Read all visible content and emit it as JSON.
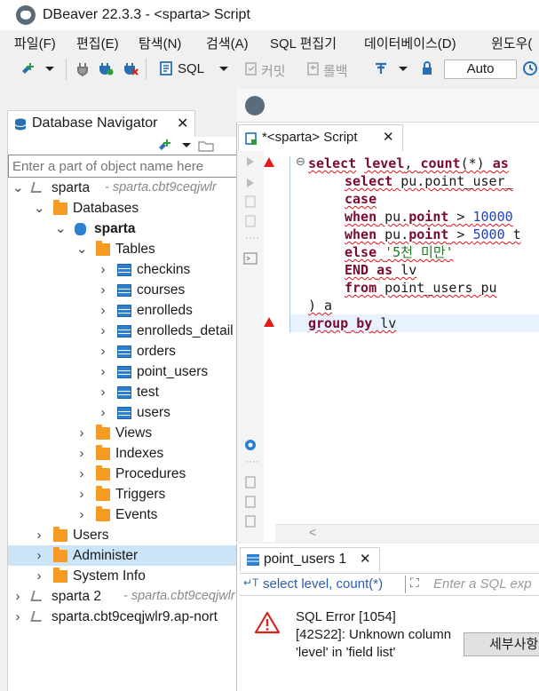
{
  "window": {
    "title": "DBeaver 22.3.3 - <sparta> Script"
  },
  "menu": [
    "파일(F)",
    "편집(E)",
    "탐색(N)",
    "검색(A)",
    "SQL 편집기",
    "데이터베이스(D)",
    "윈도우("
  ],
  "toolbar": {
    "sql_label": "SQL",
    "commit_label": "커밋",
    "rollback_label": "롤백",
    "auto_label": "Auto"
  },
  "navigator": {
    "tab_title": "Database Navigator",
    "search_placeholder": "Enter a part of object name here",
    "tree": [
      {
        "label": "sparta",
        "detail": "- sparta.cbt9ceqjwlr",
        "depth": 0,
        "expanded": true,
        "icon": "connection-icon"
      },
      {
        "label": "Databases",
        "depth": 1,
        "expanded": true,
        "icon": "databases-icon"
      },
      {
        "label": "sparta",
        "depth": 2,
        "expanded": true,
        "icon": "database-icon",
        "bold": true
      },
      {
        "label": "Tables",
        "depth": 3,
        "expanded": true,
        "icon": "tables-folder-icon"
      },
      {
        "label": "checkins",
        "depth": 4,
        "icon": "table-icon"
      },
      {
        "label": "courses",
        "depth": 4,
        "icon": "table-icon"
      },
      {
        "label": "enrolleds",
        "depth": 4,
        "icon": "table-icon"
      },
      {
        "label": "enrolleds_detail",
        "depth": 4,
        "icon": "table-icon"
      },
      {
        "label": "orders",
        "depth": 4,
        "icon": "table-icon"
      },
      {
        "label": "point_users",
        "depth": 4,
        "icon": "table-icon"
      },
      {
        "label": "test",
        "depth": 4,
        "icon": "table-icon"
      },
      {
        "label": "users",
        "depth": 4,
        "icon": "table-icon"
      },
      {
        "label": "Views",
        "depth": 3,
        "icon": "views-icon"
      },
      {
        "label": "Indexes",
        "depth": 3,
        "icon": "folder-icon"
      },
      {
        "label": "Procedures",
        "depth": 3,
        "icon": "folder-icon"
      },
      {
        "label": "Triggers",
        "depth": 3,
        "icon": "folder-icon"
      },
      {
        "label": "Events",
        "depth": 3,
        "icon": "folder-icon"
      },
      {
        "label": "Users",
        "depth": 1,
        "icon": "users-folder-icon"
      },
      {
        "label": "Administer",
        "depth": 1,
        "icon": "administer-folder-icon",
        "selected": true
      },
      {
        "label": "System Info",
        "depth": 1,
        "icon": "system-info-folder-icon"
      },
      {
        "label": "sparta 2",
        "detail": "- sparta.cbt9ceqjwlr",
        "depth": 0,
        "icon": "connection-icon"
      },
      {
        "label": "sparta.cbt9ceqjwlr9.ap-nort",
        "depth": 0,
        "icon": "connection-icon"
      }
    ]
  },
  "editor": {
    "tab_title": "*<sparta> Script",
    "code": {
      "l1": [
        "select level, count(*) as"
      ],
      "l2": "select pu.point_user_",
      "l3": "case",
      "l4a": "when pu.point > ",
      "l4b": "10000",
      "l5a": "when pu.point > ",
      "l5b": "5000 t",
      "l6a": "else ",
      "l6b": "'5천 미만'",
      "l7": "END as lv",
      "l8": "from point_users pu",
      "l9": ") a",
      "l10": "group by lv"
    }
  },
  "results": {
    "tab_title": "point_users 1",
    "filter_query": "select level, count(*)",
    "filter_placeholder": "Enter a SQL exp",
    "error_title": "SQL Error [1054]",
    "error_detail": "[42S22]: Unknown column 'level' in 'field list'",
    "detail_button": "세부사항"
  }
}
